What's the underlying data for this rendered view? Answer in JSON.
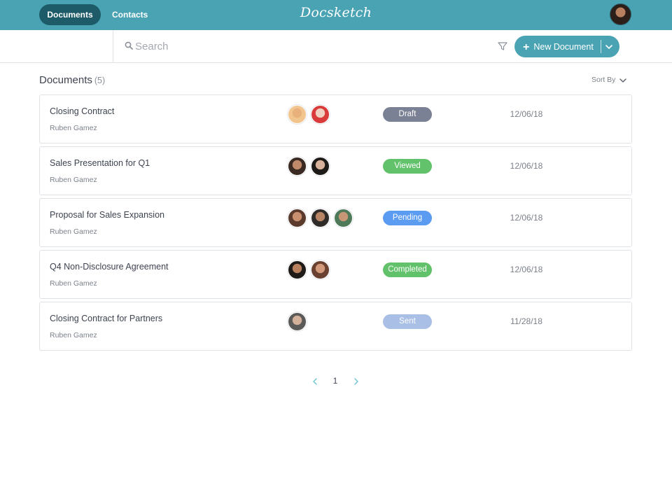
{
  "topbar": {
    "nav": [
      {
        "label": "Documents",
        "active": true
      },
      {
        "label": "Contacts",
        "active": false
      }
    ],
    "logo": "Docsketch",
    "colors": {
      "bar": "#4aa3b3",
      "active_pill": "#1d5b68"
    }
  },
  "search": {
    "placeholder": "Search",
    "value": "",
    "icon": "search-icon"
  },
  "toolbar": {
    "filter_icon": "filter-icon",
    "new_document_label": "New Document",
    "new_document_icon": "plus-icon",
    "dropdown_icon": "chevron-down-icon"
  },
  "list": {
    "title": "Documents",
    "count": "(5)",
    "sort_label": "Sort By",
    "rows": [
      {
        "title": "Closing Contract",
        "owner": "Ruben Gamez",
        "status": "Draft",
        "status_color": "#7b8194",
        "date": "12/06/18",
        "avatars": [
          {
            "skin": "#e8b07a",
            "bg": "#f2c48e"
          },
          {
            "skin": "#f0d0c0",
            "bg": "#d93a3a"
          }
        ]
      },
      {
        "title": "Sales Presentation for Q1",
        "owner": "Ruben Gamez",
        "status": "Viewed",
        "status_color": "#62c16b",
        "date": "12/06/18",
        "avatars": [
          {
            "skin": "#c08a6a",
            "bg": "#3a2a22"
          },
          {
            "skin": "#d8b19a",
            "bg": "#1e1a18"
          }
        ]
      },
      {
        "title": "Proposal for Sales Expansion",
        "owner": "Ruben Gamez",
        "status": "Pending",
        "status_color": "#5b9cf2",
        "date": "12/06/18",
        "avatars": [
          {
            "skin": "#c99070",
            "bg": "#5a3a2c"
          },
          {
            "skin": "#b78466",
            "bg": "#2e2b28"
          },
          {
            "skin": "#c69676",
            "bg": "#4f7a5a"
          }
        ]
      },
      {
        "title": "Q4 Non-Disclosure Agreement",
        "owner": "Ruben Gamez",
        "status": "Completed",
        "status_color": "#62c16b",
        "date": "12/06/18",
        "avatars": [
          {
            "skin": "#b98060",
            "bg": "#1d1a18"
          },
          {
            "skin": "#d29a7a",
            "bg": "#6a4030"
          }
        ]
      },
      {
        "title": "Closing Contract for Partners",
        "owner": "Ruben Gamez",
        "status": "Sent",
        "status_color": "#a9bfe6",
        "date": "11/28/18",
        "avatars": [
          {
            "skin": "#d3b09a",
            "bg": "#5b5a58"
          }
        ]
      }
    ]
  },
  "pagination": {
    "current_page": "1",
    "prev_icon": "chevron-left-icon",
    "next_icon": "chevron-right-icon"
  }
}
